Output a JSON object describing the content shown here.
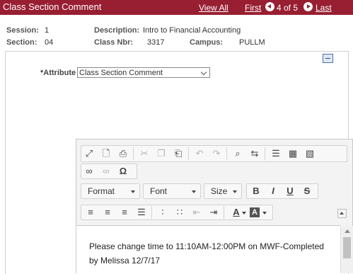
{
  "header": {
    "title": "Class Section Comment",
    "view_all": "View All",
    "first": "First",
    "position": "4 of 5",
    "last": "Last"
  },
  "info": {
    "session_label": "Session:",
    "session_value": "1",
    "section_label": "Section:",
    "section_value": "04",
    "description_label": "Description:",
    "description_value": "Intro to Financial Accounting",
    "class_nbr_label": "Class Nbr:",
    "class_nbr_value": "3317",
    "campus_label": "Campus:",
    "campus_value": "PULLM"
  },
  "attribute": {
    "label": "*Attribute",
    "value": "Class Section Comment"
  },
  "editor": {
    "format_label": "Format",
    "font_label": "Font",
    "size_label": "Size",
    "bold": "B",
    "italic": "I",
    "underline": "U",
    "strike": "S",
    "text_color": "A",
    "bg_color": "A",
    "special_char": "Ω",
    "content": "Please change time to 11:10AM-12:00PM on MWF-Completed by Melissa 12/7/17"
  }
}
